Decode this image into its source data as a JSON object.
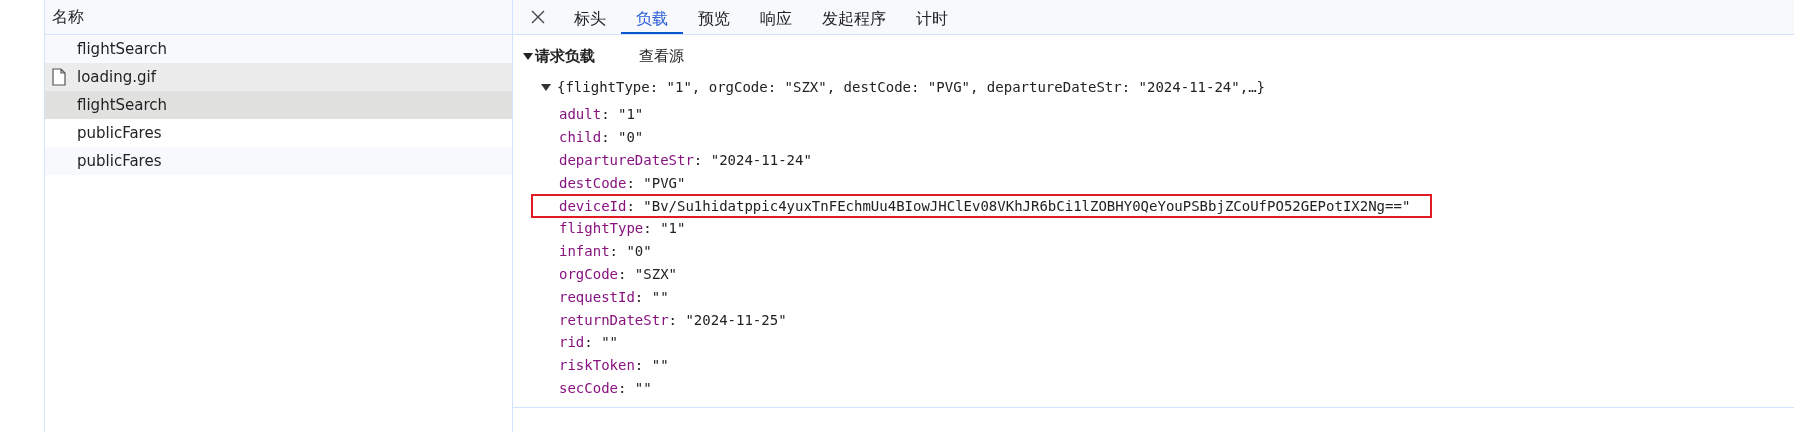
{
  "requests": {
    "column": "名称",
    "rows": [
      {
        "name": "flightSearch",
        "kind": "plain",
        "selected": false,
        "hovered": false
      },
      {
        "name": "loading.gif",
        "kind": "file",
        "selected": false,
        "hovered": true
      },
      {
        "name": "flightSearch",
        "kind": "plain",
        "selected": true,
        "hovered": false
      },
      {
        "name": "publicFares",
        "kind": "plain",
        "selected": false,
        "hovered": false
      },
      {
        "name": "publicFares",
        "kind": "plain",
        "selected": false,
        "hovered": false
      }
    ]
  },
  "tabs": [
    {
      "label": "标头",
      "selected": false
    },
    {
      "label": "负载",
      "selected": true
    },
    {
      "label": "预览",
      "selected": false
    },
    {
      "label": "响应",
      "selected": false
    },
    {
      "label": "发起程序",
      "selected": false
    },
    {
      "label": "计时",
      "selected": false
    }
  ],
  "payload": {
    "title": "请求负载",
    "view_source": "查看源",
    "expanded": true,
    "summary": "{flightType: \"1\", orgCode: \"SZX\", destCode: \"PVG\", departureDateStr: \"2024-11-24\",…}",
    "properties": [
      {
        "key": "adult",
        "value": ": \"1\"",
        "highlighted": false
      },
      {
        "key": "child",
        "value": ": \"0\"",
        "highlighted": false
      },
      {
        "key": "departureDateStr",
        "value": ": \"2024-11-24\"",
        "highlighted": false
      },
      {
        "key": "destCode",
        "value": ": \"PVG\"",
        "highlighted": false
      },
      {
        "key": "deviceId",
        "value": ": \"Bv/Su1hidatppic4yuxTnFEchmUu4BIowJHClEv08VKhJR6bCi1lZOBHY0QeYouPSBbjZCoUfPO52GEPotIX2Ng==\"",
        "highlighted": true
      },
      {
        "key": "flightType",
        "value": ": \"1\"",
        "highlighted": false
      },
      {
        "key": "infant",
        "value": ": \"0\"",
        "highlighted": false
      },
      {
        "key": "orgCode",
        "value": ": \"SZX\"",
        "highlighted": false
      },
      {
        "key": "requestId",
        "value": ": \"\"",
        "highlighted": false
      },
      {
        "key": "returnDateStr",
        "value": ": \"2024-11-25\"",
        "highlighted": false
      },
      {
        "key": "rid",
        "value": ": \"\"",
        "highlighted": false
      },
      {
        "key": "riskToken",
        "value": ": \"\"",
        "highlighted": false
      },
      {
        "key": "secCode",
        "value": ": \"\"",
        "highlighted": false
      }
    ]
  }
}
